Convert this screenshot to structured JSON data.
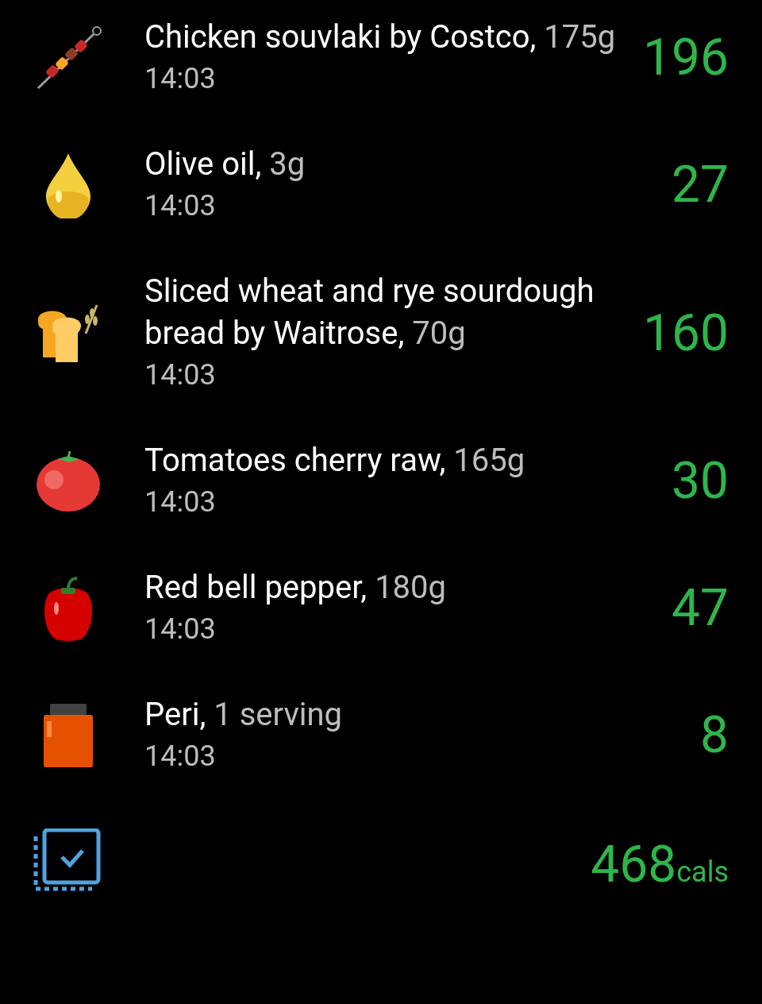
{
  "entries": [
    {
      "kind": "skewer",
      "name": "Chicken souvlaki by Costco,",
      "amount": "175g",
      "time": "14:03",
      "calories": "196"
    },
    {
      "kind": "oil",
      "name": "Olive oil,",
      "amount": "3g",
      "time": "14:03",
      "calories": "27"
    },
    {
      "kind": "bread",
      "name": "Sliced wheat and rye sourdough bread by Waitrose,",
      "amount": "70g",
      "time": "14:03",
      "calories": "160"
    },
    {
      "kind": "tomato",
      "name": "Tomatoes cherry raw,",
      "amount": "165g",
      "time": "14:03",
      "calories": "30"
    },
    {
      "kind": "pepper",
      "name": "Red bell pepper,",
      "amount": "180g",
      "time": "14:03",
      "calories": "47"
    },
    {
      "kind": "jar",
      "name": "Peri,",
      "amount": "1 serving",
      "time": "14:03",
      "calories": "8"
    }
  ],
  "total": {
    "value": "468",
    "unit": "cals"
  }
}
